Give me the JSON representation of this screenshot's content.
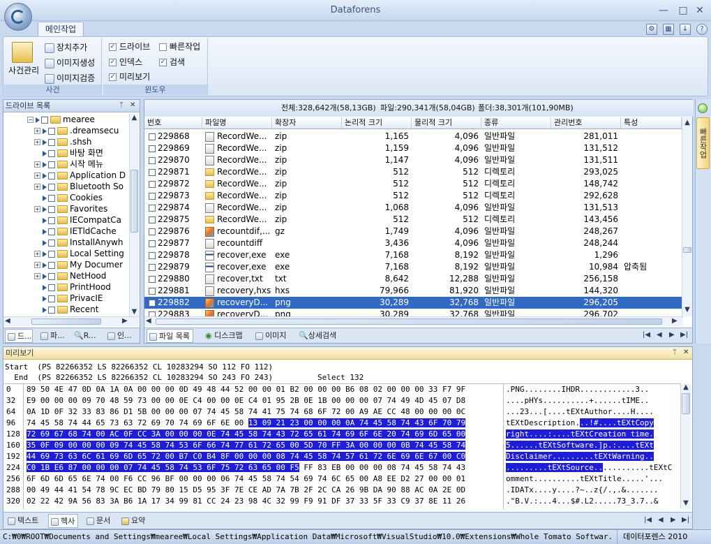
{
  "window": {
    "title": "Dataforens",
    "minimize": "—",
    "maximize": "□",
    "close": "✕"
  },
  "ribbon": {
    "tab": "메인작업",
    "case_button": "사건관리",
    "case_arrow": "˅",
    "tools": [
      "장치추가",
      "이미지생성",
      "이미지검증"
    ],
    "group_case": "사건",
    "checks": [
      {
        "label": "드라이브",
        "checked": true
      },
      {
        "label": "빠른작업",
        "checked": false
      },
      {
        "label": "인덱스",
        "checked": true
      },
      {
        "label": "검색",
        "checked": true
      },
      {
        "label": "미리보기",
        "checked": true
      }
    ],
    "group_window": "윈도우",
    "help": "?"
  },
  "drive_panel": {
    "title": "드라이브 목록",
    "pin": "ᛘ",
    "close": "✕",
    "tree": [
      {
        "label": "mearee",
        "level": 0,
        "exp": "−",
        "tri": false
      },
      {
        "label": ".dreamsecu",
        "level": 1,
        "exp": "+",
        "tri": true
      },
      {
        "label": ".shsh",
        "level": 1,
        "exp": "+",
        "tri": true
      },
      {
        "label": "바탕 화면",
        "level": 1,
        "exp": "",
        "tri": true
      },
      {
        "label": "시작 메뉴",
        "level": 1,
        "exp": "+",
        "tri": true
      },
      {
        "label": "Application D",
        "level": 1,
        "exp": "+",
        "tri": true
      },
      {
        "label": "Bluetooth So",
        "level": 1,
        "exp": "+",
        "tri": true
      },
      {
        "label": "Cookies",
        "level": 1,
        "exp": "",
        "tri": true
      },
      {
        "label": "Favorites",
        "level": 1,
        "exp": "+",
        "tri": true
      },
      {
        "label": "IECompatCa",
        "level": 1,
        "exp": "",
        "tri": true
      },
      {
        "label": "IETldCache",
        "level": 1,
        "exp": "",
        "tri": true
      },
      {
        "label": "InstallAnywh",
        "level": 1,
        "exp": "",
        "tri": true
      },
      {
        "label": "Local Setting",
        "level": 1,
        "exp": "+",
        "tri": true
      },
      {
        "label": "My Documer",
        "level": 1,
        "exp": "+",
        "tri": true
      },
      {
        "label": "NetHood",
        "level": 1,
        "exp": "+",
        "tri": true
      },
      {
        "label": "PrintHood",
        "level": 1,
        "exp": "",
        "tri": true
      },
      {
        "label": "PrivacIE",
        "level": 1,
        "exp": "",
        "tri": true
      },
      {
        "label": "Recent",
        "level": 1,
        "exp": "",
        "tri": true
      }
    ],
    "tabs": [
      "드...",
      "파...",
      "R...",
      "인..."
    ]
  },
  "file_list": {
    "summary": {
      "total": "전체:328,642개(58,13GB)",
      "files": "파일:290,341개(58,04GB)",
      "folders": "폴더:38,301개(101,90MB)"
    },
    "columns": [
      "번호",
      "파일명",
      "확장자",
      "논리적 크기",
      "물리적 크기",
      "종류",
      "관리번호",
      "특성"
    ],
    "rows": [
      {
        "no": "229868",
        "name": "RecordWe...",
        "ext": "zip",
        "logical": "1,165",
        "physical": "4,096",
        "kind": "일반파일",
        "mgmt": "281,011",
        "attr": "",
        "icon": "doc"
      },
      {
        "no": "229869",
        "name": "RecordWe...",
        "ext": "zip",
        "logical": "1,159",
        "physical": "4,096",
        "kind": "일반파일",
        "mgmt": "131,512",
        "attr": "",
        "icon": "doc"
      },
      {
        "no": "229870",
        "name": "RecordWe...",
        "ext": "zip",
        "logical": "1,147",
        "physical": "4,096",
        "kind": "일반파일",
        "mgmt": "131,511",
        "attr": "",
        "icon": "doc"
      },
      {
        "no": "229871",
        "name": "RecordWe...",
        "ext": "zip",
        "logical": "512",
        "physical": "512",
        "kind": "디렉토리",
        "mgmt": "293,025",
        "attr": "",
        "icon": "fold"
      },
      {
        "no": "229872",
        "name": "RecordWe...",
        "ext": "zip",
        "logical": "512",
        "physical": "512",
        "kind": "디렉토리",
        "mgmt": "148,742",
        "attr": "",
        "icon": "fold"
      },
      {
        "no": "229873",
        "name": "RecordWe...",
        "ext": "zip",
        "logical": "512",
        "physical": "512",
        "kind": "디렉토리",
        "mgmt": "292,628",
        "attr": "",
        "icon": "fold"
      },
      {
        "no": "229874",
        "name": "RecordWe...",
        "ext": "zip",
        "logical": "1,068",
        "physical": "4,096",
        "kind": "일반파일",
        "mgmt": "131,513",
        "attr": "",
        "icon": "doc"
      },
      {
        "no": "229875",
        "name": "RecordWe...",
        "ext": "zip",
        "logical": "512",
        "physical": "512",
        "kind": "디렉토리",
        "mgmt": "143,456",
        "attr": "",
        "icon": "fold"
      },
      {
        "no": "229876",
        "name": "recountdif,...",
        "ext": "gz",
        "logical": "1,749",
        "physical": "4,096",
        "kind": "일반파일",
        "mgmt": "248,267",
        "attr": "",
        "icon": "img"
      },
      {
        "no": "229877",
        "name": "recountdiff",
        "ext": "",
        "logical": "3,436",
        "physical": "4,096",
        "kind": "일반파일",
        "mgmt": "248,244",
        "attr": "",
        "icon": "doc"
      },
      {
        "no": "229878",
        "name": "recover,exe",
        "ext": "exe",
        "logical": "7,168",
        "physical": "8,192",
        "kind": "일반파일",
        "mgmt": "1,296",
        "attr": "",
        "icon": "exe"
      },
      {
        "no": "229879",
        "name": "recover,exe",
        "ext": "exe",
        "logical": "7,168",
        "physical": "8,192",
        "kind": "일반파일",
        "mgmt": "10,984",
        "attr": "압축됨",
        "icon": "exe"
      },
      {
        "no": "229880",
        "name": "recover,txt",
        "ext": "txt",
        "logical": "8,642",
        "physical": "12,288",
        "kind": "일반파일",
        "mgmt": "256,158",
        "attr": "",
        "icon": "doc"
      },
      {
        "no": "229881",
        "name": "recovery,hxs",
        "ext": "hxs",
        "logical": "79,966",
        "physical": "81,920",
        "kind": "일반파일",
        "mgmt": "144,320",
        "attr": "",
        "icon": "doc"
      },
      {
        "no": "229882",
        "name": "recoveryD...",
        "ext": "png",
        "logical": "30,289",
        "physical": "32,768",
        "kind": "일반파일",
        "mgmt": "296,205",
        "attr": "",
        "icon": "img"
      },
      {
        "no": "229883",
        "name": "recoveryD...",
        "ext": "png",
        "logical": "30,289",
        "physical": "32,768",
        "kind": "일반파일",
        "mgmt": "296,702",
        "attr": "",
        "icon": "img"
      }
    ],
    "selected_row": 14,
    "tabs": [
      "파일 목록",
      "디스크맵",
      "이미지",
      "상세검색"
    ]
  },
  "side_tab": "빠른작업",
  "preview": {
    "title": "미리보기",
    "start": "Start  (PS 82266352 LS 82266352 CL 10283294 SO 112 FO 112)",
    "end": "  End  (PS 82266352 LS 82266352 CL 10283294 SO 243 FO 243)",
    "select": "Select 132",
    "hex": [
      {
        "off": "0",
        "pre": "89 50 4E 47 0D 0A 1A 0A 00 00 00 0D 49 48 44 52 00 00 01 B2 00 00 00 B6 08 02 00 00 00 33 F7 9F",
        "sel": "",
        "post": "",
        "ascii_pre": ".PNG........IHDR............3..",
        "ascii_sel": "",
        "ascii_post": ""
      },
      {
        "off": "32",
        "pre": "E9 00 00 00 09 70 48 59 73 00 00 0E C4 00 00 0E C4 01 95 2B 0E 1B 00 00 00 07 74 49 4D 45 07 D8",
        "sel": "",
        "post": "",
        "ascii_pre": "....pHYs..........+......tIME..",
        "ascii_sel": "",
        "ascii_post": ""
      },
      {
        "off": "64",
        "pre": "0A 1D 0F 32 33 83 86 D1 5B 00 00 00 07 74 45 58 74 41 75 74 68 6F 72 00 A9 AE CC 48 00 00 00 0C",
        "sel": "",
        "post": "",
        "ascii_pre": "...23...[....tEXtAuthor....H....",
        "ascii_sel": "",
        "ascii_post": ""
      },
      {
        "off": "96",
        "pre": "74 45 58 74 44 65 73 63 72 69 70 74 69 6F 6E 00 ",
        "sel": "13 09 21 23 00 00 00 0A 74 45 58 74 43 6F 70 79",
        "post": "",
        "ascii_pre": "tEXtDescription.",
        "ascii_sel": "..!#....tEXtCopy",
        "ascii_post": ""
      },
      {
        "off": "128",
        "pre": "",
        "sel": "72 69 67 68 74 00 AC 0F CC 3A 00 00 00 0E 74 45 58 74 43 72 65 61 74 69 6F 6E 20 74 69 6D 65 00",
        "post": "",
        "ascii_pre": "",
        "ascii_sel": "right....:....tEXtCreation time.",
        "ascii_post": ""
      },
      {
        "off": "160",
        "pre": "",
        "sel": "35 0F 09 00 00 00 09 74 45 58 74 53 6F 66 74 77 61 72 65 00 5D 70 FF 3A 00 00 00 0B 74 45 58 74",
        "post": "",
        "ascii_pre": "",
        "ascii_sel": "5......tEXtSoftware.]p.:....tEXt",
        "ascii_post": ""
      },
      {
        "off": "192",
        "pre": "",
        "sel": "44 69 73 63 6C 61 69 6D 65 72 00 B7 C0 B4 8F 00 00 00 08 74 45 58 74 57 61 72 6E 69 6E 67 00 C0",
        "post": "",
        "ascii_pre": "",
        "ascii_sel": "Disclaimer.........tEXtWarning..",
        "ascii_post": ""
      },
      {
        "off": "224",
        "pre": "",
        "sel": "C0 1B E6 87 00 00 00 07 74 45 58 74 53 6F 75 72 63 65 00 F5",
        "post": " FF 83 EB 00 00 00 08 74 45 58 74 43",
        "ascii_pre": "",
        "ascii_sel": ".........tEXtSource..",
        "ascii_post": "..........tEXtC"
      },
      {
        "off": "256",
        "pre": "6F 6D 6D 65 6E 74 00 F6 CC 96 BF 00 00 00 06 74 45 58 74 54 69 74 6C 65 00 A8 EE D2 27 00 00 01",
        "sel": "",
        "post": "",
        "ascii_pre": "omment..........tEXtTitle.....'...",
        "ascii_sel": "",
        "ascii_post": ""
      },
      {
        "off": "288",
        "pre": "00 49 44 41 54 78 9C EC BD 79 80 15 D5 95 3F 7E CE AD 7A 7B 2F 2C CA 26 9B DA 90 88 AC 0A 2E 0D",
        "sel": "",
        "post": "",
        "ascii_pre": ".IDATx....y....?~..z{/.,.&.......",
        "ascii_sel": "",
        "ascii_post": ""
      },
      {
        "off": "320",
        "pre": "02 22 42 9A 56 83 3A B6 1A 17 34 99 81 CC 24 23 98 4C 32 99 F9 91 DF 37 33 5F 33 C9 37 8E 11 26",
        "sel": "",
        "post": "",
        "ascii_pre": ".\"B.V.:...4...$#.L2.....73_3.7..&",
        "ascii_sel": "",
        "ascii_post": ""
      },
      {
        "off": "352",
        "pre": "C9 37 03 59 14 35 63 82 51 31 DA DD 20 BB 08 12 37 16 BB AD BB 65 15 E8 66 EF E5 6D F5 AA EE F9",
        "sel": "",
        "post": "",
        "ascii_pre": ".7.Y.5c.Q1.... ....7.....e..f..m....",
        "ascii_sel": "",
        "ascii_post": ""
      },
      {
        "off": "384",
        "pre": "FE 71 AB EA 55 D5 AB 7A FD BA 69 A2 91 FA A4 23 AF 6E DD 7B EE B9 F7 D6 FD DC 73 77 6C 6F 6F D7",
        "sel": "",
        "post": "",
        "ascii_pre": ".q..U..z..i....#.n.{......sw1oo.",
        "ascii_sel": "",
        "ascii_post": ""
      },
      {
        "off": "416",
        "pre": "34 6D F9 F2 E5 C7 8F 1F 3F 70 E0 C0 E9 04 68 9A 0A 40 5C D3 10 10 04 D0 F8 F1 39 00 91 FE 2F 90",
        "sel": "",
        "post": "",
        "ascii_pre": "4m......?p....h..@\\........9.../.",
        "ascii_sel": "",
        "ascii_post": ""
      },
      {
        "off": "448",
        "pre": "78 22 C3 05 80 38 17 8E 64 F1 4E E0 C3 87 8F CF 29 88 A8 A8 A4 74 60 AF 70 2C 16 FB E6 37 BF 19",
        "sel": "",
        "post": "",
        "ascii_pre": "x\"...8..d.N......)....t`.p,...7..",
        "ascii_sel": "",
        "ascii_post": ""
      }
    ],
    "tabs": [
      "텍스트",
      "헥사",
      "문서",
      "요약"
    ]
  },
  "status": {
    "path": "C:₩0₩ROOT₩Documents and Settings₩mearee₩Local Settings₩Application Data₩Microsoft₩VisualStudio₩10.0₩Extensions₩Whole Tomato Softwar...",
    "product": "데이터포렌스 2010"
  },
  "nav": {
    "first": "|◀",
    "prev": "◀",
    "next": "▶",
    "last": "▶|"
  }
}
